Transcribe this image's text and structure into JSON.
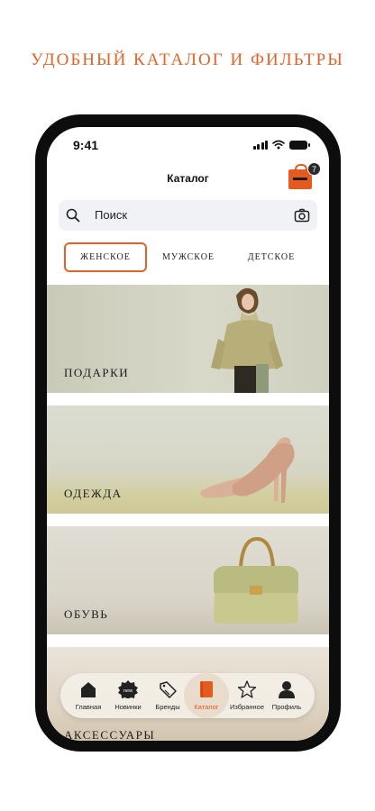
{
  "headline": "УДОБНЫЙ КАТАЛОГ И ФИЛЬТРЫ",
  "status_bar": {
    "time": "9:41"
  },
  "header": {
    "title": "Каталог",
    "cart_count": "7",
    "cart_icon": "shopping-bag-icon"
  },
  "search": {
    "placeholder": "Поиск",
    "search_icon": "search-icon",
    "camera_icon": "camera-icon"
  },
  "tabs": [
    {
      "label": "ЖЕНСКОЕ",
      "active": true
    },
    {
      "label": "МУЖСКОЕ",
      "active": false
    },
    {
      "label": "ДЕТСКОЕ",
      "active": false
    }
  ],
  "categories": [
    {
      "label": "ПОДАРКИ"
    },
    {
      "label": "ОДЕЖДА"
    },
    {
      "label": "ОБУВЬ"
    },
    {
      "label": "АКСЕССУАРЫ"
    }
  ],
  "bottom_nav": [
    {
      "label": "Главная",
      "icon": "home-icon"
    },
    {
      "label": "Новинки",
      "icon": "new-badge-icon",
      "icon_text": "new"
    },
    {
      "label": "Бренды",
      "icon": "tag-icon"
    },
    {
      "label": "Каталог",
      "icon": "catalog-book-icon",
      "active": true
    },
    {
      "label": "Избранное",
      "icon": "star-icon"
    },
    {
      "label": "Профиль",
      "icon": "profile-icon"
    }
  ],
  "colors": {
    "accent": "#e0642a",
    "cart": "#e55a1f",
    "phone_frame": "#0d0d0d"
  }
}
